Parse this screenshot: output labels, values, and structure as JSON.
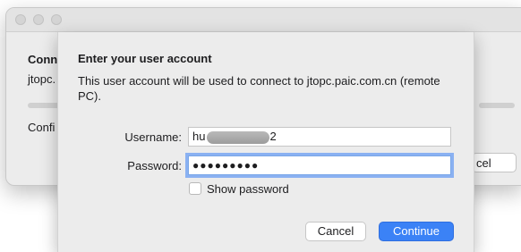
{
  "background_window": {
    "heading_partial": "Conn",
    "host_partial": "jtopc.",
    "config_partial": "Confi",
    "cancel_partial": "cel"
  },
  "sheet": {
    "title": "Enter your user account",
    "description": "This user account will be used to connect to jtopc.paic.com.cn (remote PC).",
    "username_label": "Username:",
    "username_prefix": "hu",
    "username_suffix": "2",
    "password_label": "Password:",
    "password_mask": "●●●●●●●●●",
    "show_password_label": "Show password",
    "show_password_checked": false,
    "cancel_label": "Cancel",
    "continue_label": "Continue"
  },
  "colors": {
    "primary_button": "#3b82f6",
    "focus_ring": "#3a82f7"
  }
}
